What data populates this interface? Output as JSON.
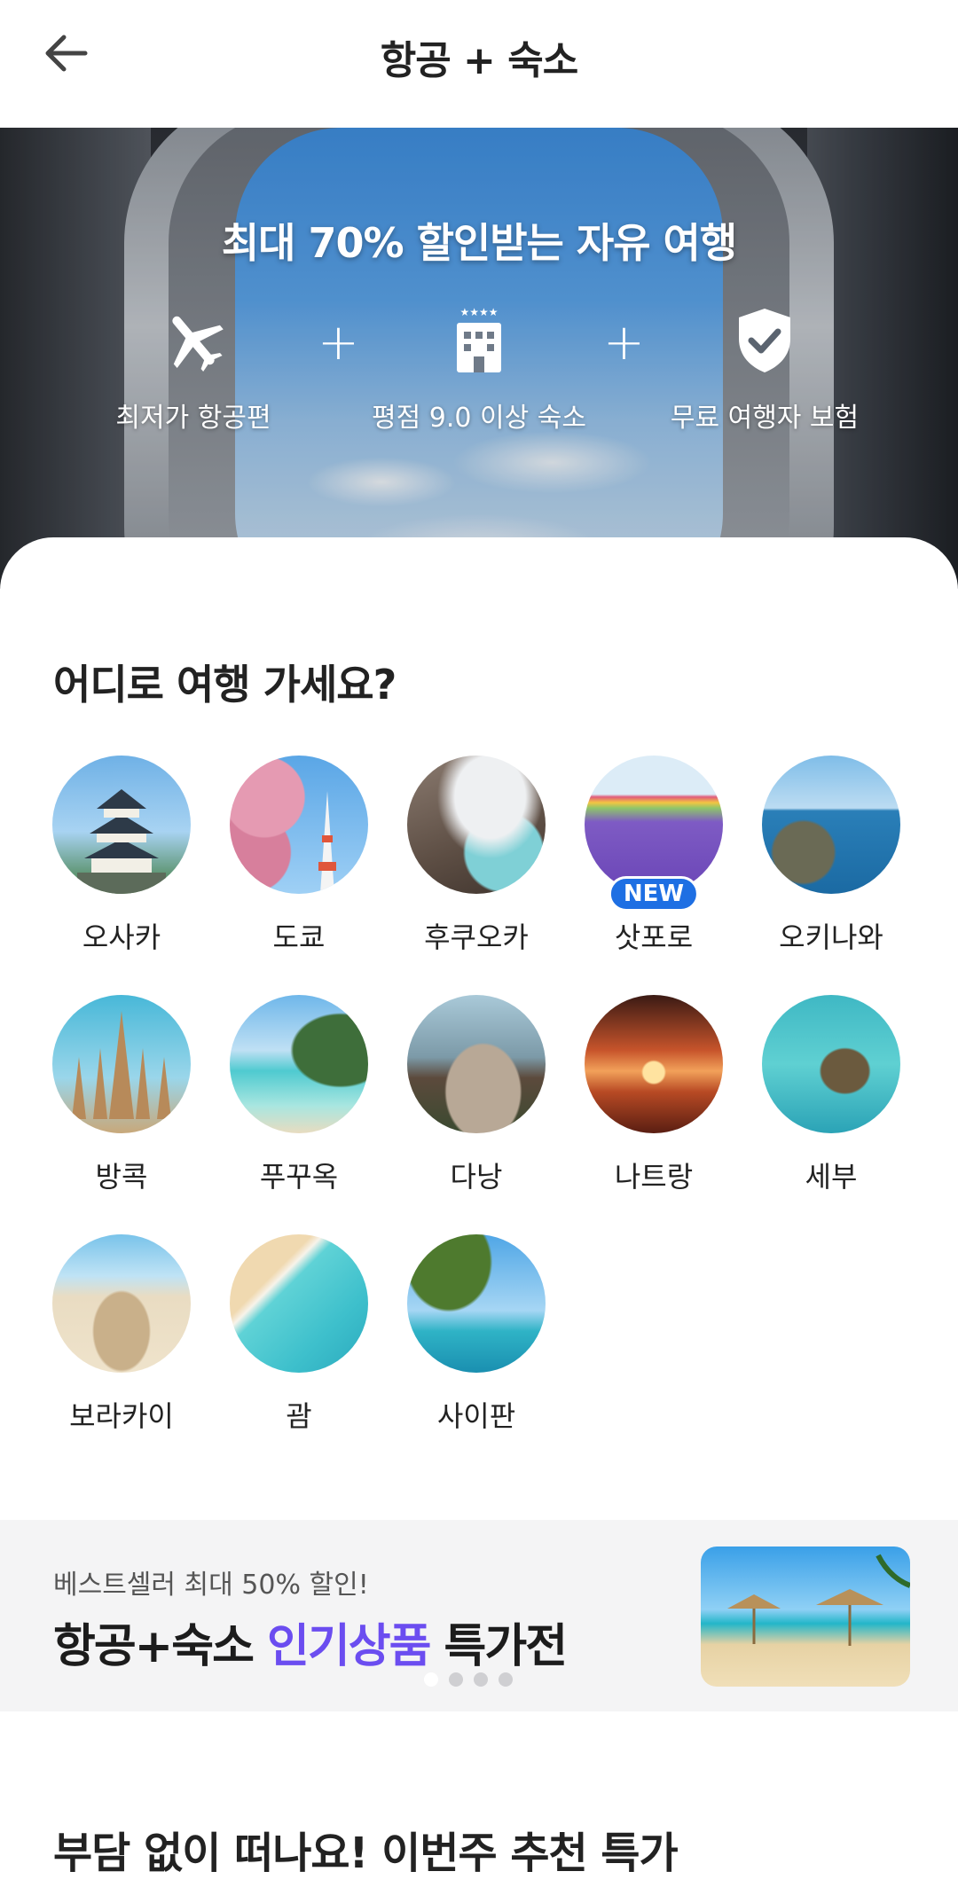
{
  "header": {
    "title": "항공 + 숙소"
  },
  "hero": {
    "headline": "최대 70% 할인받는 자유 여행",
    "benefits": [
      {
        "label": "최저가 항공편",
        "icon": "airplane-icon"
      },
      {
        "label": "평점 9.0 이상 숙소",
        "icon": "hotel-icon"
      },
      {
        "label": "무료 여행자 보험",
        "icon": "shield-check-icon"
      }
    ],
    "plus": "+"
  },
  "destinations": {
    "title": "어디로 여행 가세요?",
    "items": [
      {
        "name": "오사카",
        "badge": ""
      },
      {
        "name": "도쿄",
        "badge": ""
      },
      {
        "name": "후쿠오카",
        "badge": ""
      },
      {
        "name": "삿포로",
        "badge": "NEW"
      },
      {
        "name": "오키나와",
        "badge": ""
      },
      {
        "name": "방콕",
        "badge": ""
      },
      {
        "name": "푸꾸옥",
        "badge": ""
      },
      {
        "name": "다낭",
        "badge": ""
      },
      {
        "name": "나트랑",
        "badge": ""
      },
      {
        "name": "세부",
        "badge": ""
      },
      {
        "name": "보라카이",
        "badge": ""
      },
      {
        "name": "괌",
        "badge": ""
      },
      {
        "name": "사이판",
        "badge": ""
      }
    ]
  },
  "banner": {
    "subtitle": "베스트셀러 최대 50% 할인!",
    "title_pre": "항공+숙소 ",
    "title_highlight": "인기상품",
    "title_post": " 특가전",
    "page_count": 4,
    "active_page": 1
  },
  "recommend": {
    "title": "부담 없이 떠나요! 이번주 추천 특가"
  },
  "colors": {
    "accent": "#1e6fe3",
    "highlight": "#6b4df0",
    "banner_bg": "#f4f4f5"
  }
}
